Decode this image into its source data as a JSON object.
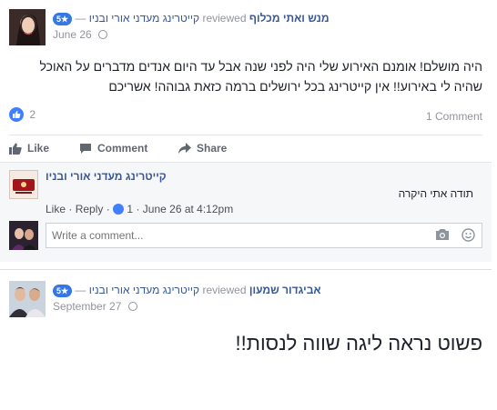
{
  "reviews": [
    {
      "rating": "5★",
      "page_name": "קייטרינג מעדני אורי ובניו",
      "reviewed_label": "reviewed",
      "reviewer": "מנש ואתי מכלוף",
      "date": "June 26",
      "text": "היה מושלם! אומנם האירוע שלי היה לפני שנה אבל עד היום אנדים מדברים על האוכל שהיה לי באירוע!! אין קייטרינג בכל ירושלים ברמה כזאת גבוהה! אשריכם",
      "like_count": "2",
      "comment_count": "1 Comment",
      "actions": {
        "like": "Like",
        "comment": "Comment",
        "share": "Share"
      },
      "comment": {
        "author": "קייטרינג מעדני אורי ובניו",
        "text": "תודה אתי היקרה",
        "like_link": "Like",
        "reply_link": "Reply",
        "like_count": "1",
        "timestamp": "June 26 at 4:12pm"
      },
      "comment_placeholder": "Write a comment..."
    },
    {
      "rating": "5★",
      "page_name": "קייטרינג מעדני אורי ובניו",
      "reviewed_label": "reviewed",
      "reviewer": "אביגדור שמעון",
      "date": "September 27",
      "text": "פשוט נראה ליגה שווה לנסות!!"
    }
  ],
  "colors": {
    "accent": "#365899",
    "like_blue": "#4080ff",
    "badge": "#3578e5"
  },
  "icons": [
    "globe-icon",
    "thumbs-up-icon",
    "comment-icon",
    "share-icon",
    "camera-icon",
    "smiley-icon"
  ]
}
